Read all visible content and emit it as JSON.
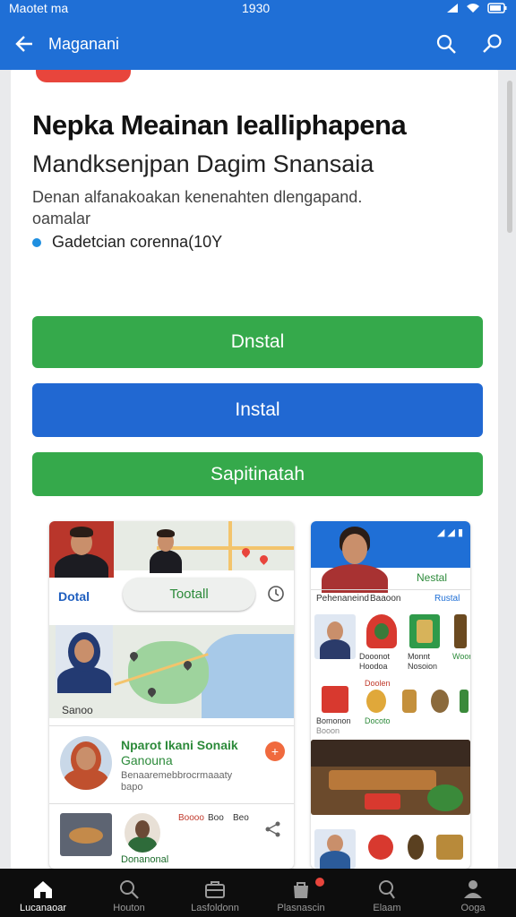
{
  "status": {
    "left": "Maotet  ma",
    "center": "1930"
  },
  "appbar": {
    "title": "Maganani"
  },
  "content": {
    "title": "Nepka Meainan Iealliphapena",
    "subtitle": "Mandksenjpan Dagim Snansaia",
    "description": "Denan alfanakoakan kenenahten dlengapand. oamalar",
    "bullet": "Gadetcian corenna(10Y"
  },
  "buttons": {
    "primary": "Dnstal",
    "install": "Instal",
    "secondary": "Sapitinatah"
  },
  "screenshot_left": {
    "tab_label": "Dotal",
    "pill_label": "Tootall",
    "map_caption": "Sanoo",
    "contact_title": "Nparot Ikani Sonaik",
    "contact_subtitle": "Ganouna",
    "contact_line": "Benaaremebbrocrmaaaty",
    "contact_line2": "bapo",
    "row_label_1": "Boooo",
    "row_label_2": "Boo",
    "row_label_3": "Beo",
    "bottom_label": "Donanonal"
  },
  "screenshot_right": {
    "tab_label": "Nestal",
    "header_left": "Pehenaneind",
    "header_right": "Baaoon",
    "header_link": "Rustal",
    "row1": [
      "Dooonot",
      "Monnt",
      "Woon"
    ],
    "row1b": [
      "Hoodoa",
      "Nosoion"
    ],
    "row2_label": "Doolen",
    "row2": [
      "Bomonon",
      "Docoto"
    ],
    "row2b": "Booon"
  },
  "bottom_nav": [
    {
      "label": "Lucanaoar",
      "icon": "home-icon",
      "active": true
    },
    {
      "label": "Houton",
      "icon": "search-icon",
      "active": false
    },
    {
      "label": "Lasfoldonn",
      "icon": "briefcase-icon",
      "active": false
    },
    {
      "label": "Plasnascin",
      "icon": "bag-icon",
      "active": false
    },
    {
      "label": "Elaam",
      "icon": "search-icon",
      "active": false
    },
    {
      "label": "Ooga",
      "icon": "person-icon",
      "active": false
    }
  ],
  "colors": {
    "appbar": "#1f6fd6",
    "green_button": "#35a94b",
    "blue_button": "#2168d2",
    "accent_red": "#e8453c"
  }
}
